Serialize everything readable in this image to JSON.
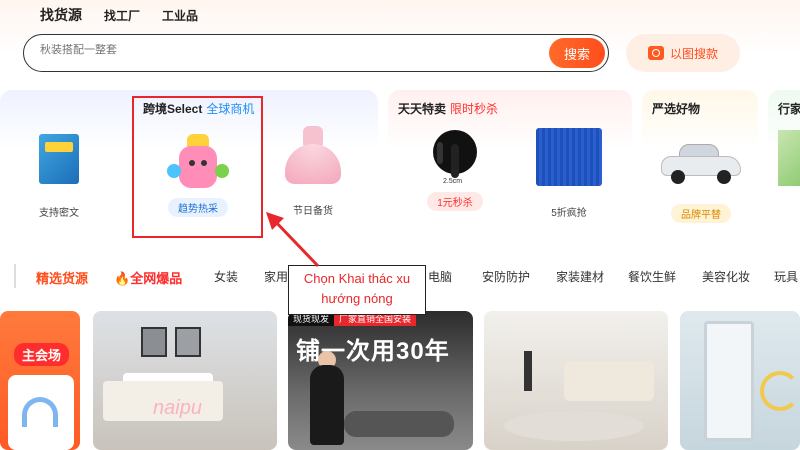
{
  "top_tabs": [
    "找货源",
    "找工厂",
    "工业品"
  ],
  "search": {
    "placeholder": "秋装搭配一整套",
    "button": "搜索",
    "image_search": "以图搜款"
  },
  "cards": {
    "cross_border": {
      "title": "跨境Select",
      "subtitle": "全球商机",
      "subtitle_color": "#1f8ef1",
      "products": [
        {
          "label": "支持密文"
        },
        {
          "label": "趋势热采",
          "pill": true
        },
        {
          "label": "节日备货"
        }
      ]
    },
    "daily_deals": {
      "title": "天天特卖",
      "subtitle": "限时秒杀",
      "subtitle_color": "#ff2d2d",
      "products": [
        {
          "label": "1元秒杀",
          "pill": true,
          "image_text": "2.5cm"
        },
        {
          "label": "5折疯抢"
        }
      ]
    },
    "curated": {
      "title": "严选好物",
      "products": [
        {
          "label": "品牌平替",
          "pill": true
        }
      ]
    },
    "partial_title": "行家"
  },
  "categories": [
    "精选货源",
    "全网爆品",
    "女装",
    "家用",
    "电脑",
    "安防防护",
    "家装建材",
    "餐饮生鲜",
    "美容化妆",
    "玩具"
  ],
  "annotation": "Chọn Khai thác xu hướng nóng",
  "tiles": {
    "main_venue": "主会场",
    "ribbon_left": "现货现发",
    "ribbon_right": "厂家直销全国安装",
    "slogan": "铺一次用30年",
    "watermark": "naipu"
  },
  "colors": {
    "accent": "#ff4d1c",
    "highlight": "#e8272c"
  }
}
